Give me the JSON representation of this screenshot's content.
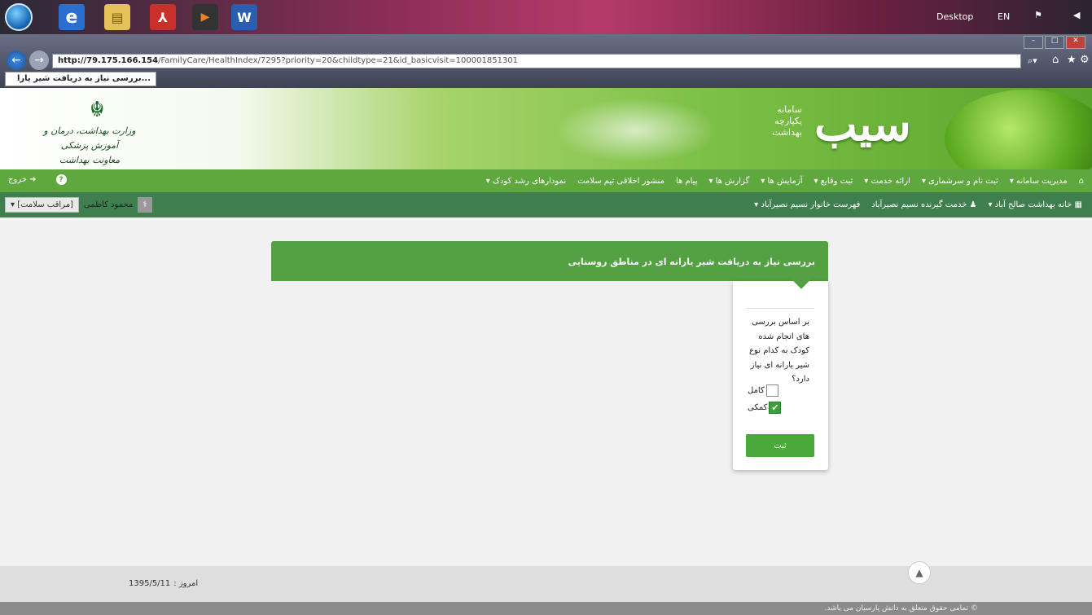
{
  "taskbar": {
    "apps": [
      "ie-icon",
      "explorer-icon",
      "pdf-icon",
      "media-icon",
      "word-icon"
    ],
    "desktop_label": "Desktop",
    "lang": "EN"
  },
  "browser": {
    "url_host": "http://79.175.166.154",
    "url_rest": "/FamilyCare/HealthIndex/7295?priority=20&childtype=21&id_basicvisit=100001851301",
    "tab_title": "...بررسی نیاز به دریافت شیر یارا"
  },
  "header": {
    "ministry_line1": "وزارت بهداشت، درمان و آموزش پزشکی",
    "ministry_line2": "معاونت بهداشت",
    "logo": "سیب",
    "subtitle_1": "سامانه",
    "subtitle_2": "یکپارچه",
    "subtitle_3": "بهداشت"
  },
  "nav": {
    "items": [
      "مدیریت سامانه ▾",
      "ثبت نام و سرشماری ▾",
      "ارائه خدمت ▾",
      "ثبت وقایع ▾",
      "آزمایش ها ▾",
      "گزارش ها ▾",
      "پیام ها",
      "منشور اخلاقی تیم سلامت",
      "نمودارهای رشد کودک ▾"
    ],
    "logout": "خروج"
  },
  "subnav": {
    "items": [
      "خانه بهداشت صالح آباد ▾",
      "خدمت گیرنده نسیم نصیرآباد",
      "فهرست خانوار نسیم نصیرآباد ▾"
    ],
    "user_name": "محمود کاظمی",
    "user_role": "[مراقب سلامت] ▾"
  },
  "panel": {
    "title": "بررسی نیاز به دریافت شیر یارانه ای در مناطق روستایی",
    "question": "بر اساس بررسی های انجام شده کودک به کدام نوع شیر یارانه ای نیاز دارد؟",
    "options": [
      {
        "label": "کامل",
        "checked": false
      },
      {
        "label": "کمکی",
        "checked": true
      }
    ],
    "submit_label": "ثبت"
  },
  "footer": {
    "today_label": "امروز :",
    "today_value": "1395/5/11",
    "copyright": "© تمامی حقوق متعلق به دانش پارسیان می باشد."
  }
}
